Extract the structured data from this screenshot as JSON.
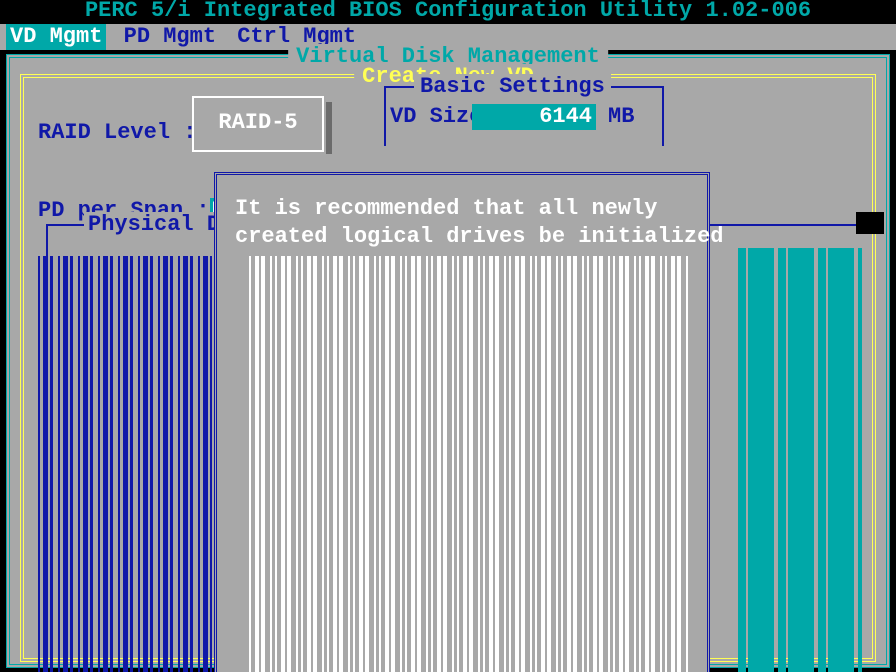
{
  "title": "PERC 5/i Integrated BIOS Configuration Utility 1.02-006",
  "menu": {
    "vd": "VD Mgmt",
    "pd": "PD Mgmt",
    "ctrl": "Ctrl Mgmt"
  },
  "frames": {
    "outer": "Virtual Disk Management",
    "inner": "Create New VD",
    "basic": "Basic Settings",
    "phys": "Physical Disks"
  },
  "labels": {
    "raid_level": "RAID Level :",
    "vd_size": "VD Size:",
    "mb": "MB",
    "pd_per_span": "PD per Span :"
  },
  "values": {
    "raid_level": "RAID-5",
    "vd_size": "6144",
    "pd_per_span": "N/A"
  },
  "popup": {
    "line1": "It is recommended that all newly",
    "line2": "created logical drives be initialized"
  }
}
